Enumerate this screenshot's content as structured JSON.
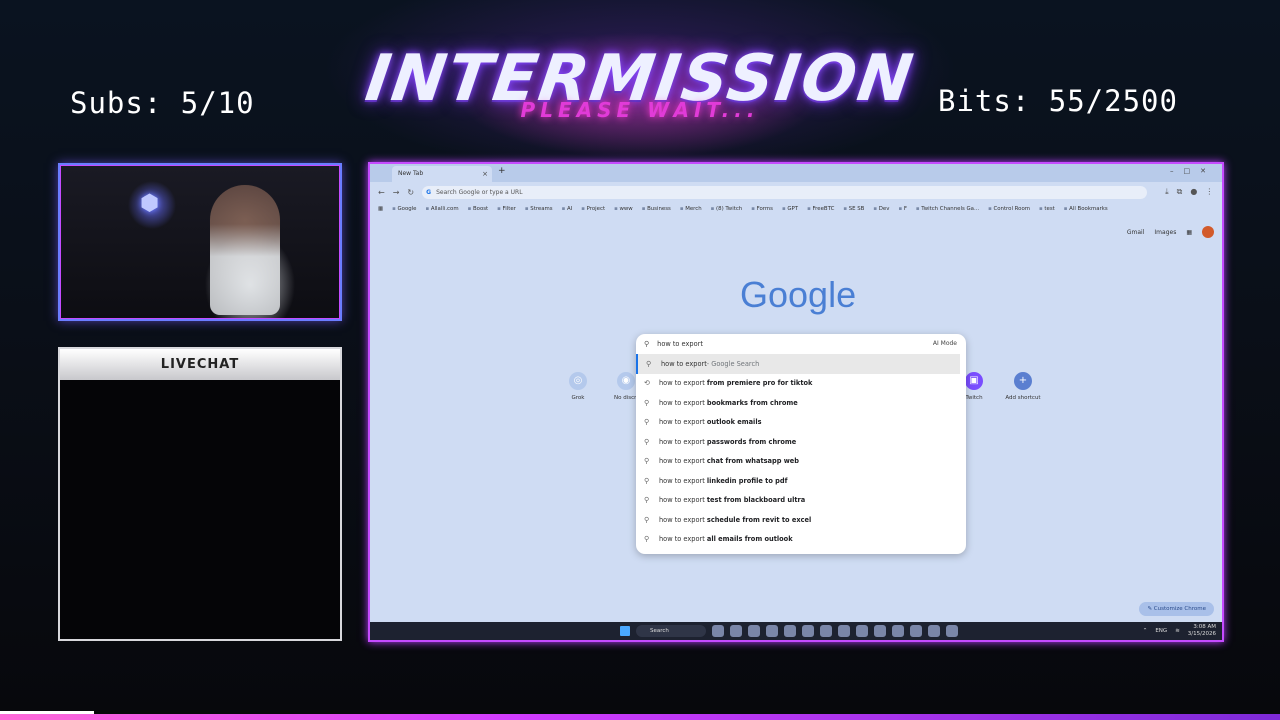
{
  "overlay": {
    "title": "INTERMISSION",
    "subtitle": "PLEASE WAIT...",
    "subs": "Subs: 5/10",
    "bits": "Bits: 55/2500",
    "chat_header": "LIVECHAT"
  },
  "browser": {
    "tab_title": "New Tab",
    "tab_close": "×",
    "new_tab": "+",
    "omnibox_placeholder": "Search Google or type a URL",
    "bookmarks": [
      "Google",
      "Allalli.com",
      "Boost",
      "Filter",
      "Streams",
      "AI",
      "Project",
      "www",
      "Business",
      "Merch",
      "(8) Twitch",
      "Forms",
      "GPT",
      "FreeBTC",
      "SE SB",
      "Dev",
      "F",
      "Twitch Channels Ga...",
      "Control Room",
      "test",
      "All Bookmarks"
    ],
    "top_links": {
      "gmail": "Gmail",
      "images": "Images"
    },
    "google_logo": "Google",
    "shortcuts": {
      "grok": "Grok",
      "no_disc": "No discri",
      "twitch": "Twitch",
      "add": "Add shortcut"
    },
    "search": {
      "query": "how to export",
      "ai_mode": "AI Mode",
      "google_search_suffix": " - Google Search",
      "suggestions": [
        {
          "prefix": "how to export",
          "suffix": "from premiere pro for tiktok"
        },
        {
          "prefix": "how to export",
          "suffix": "bookmarks from chrome"
        },
        {
          "prefix": "how to export",
          "suffix": "outlook emails"
        },
        {
          "prefix": "how to export",
          "suffix": "passwords from chrome"
        },
        {
          "prefix": "how to export",
          "suffix": "chat from whatsapp web"
        },
        {
          "prefix": "how to export",
          "suffix": "linkedin profile to pdf"
        },
        {
          "prefix": "how to export",
          "suffix": "test from blackboard ultra"
        },
        {
          "prefix": "how to export",
          "suffix": "schedule from revit to excel"
        },
        {
          "prefix": "how to export",
          "suffix": "all emails from outlook"
        }
      ]
    },
    "customize": "Customize Chrome",
    "taskbar": {
      "search": "Search",
      "lang": "ENG",
      "time": "3:08 AM",
      "date": "3/15/2026"
    }
  },
  "colors": {
    "accent_purple": "#c54bff",
    "google_blue": "#4a7fd4",
    "subtitle_pink": "#e13bd8"
  }
}
